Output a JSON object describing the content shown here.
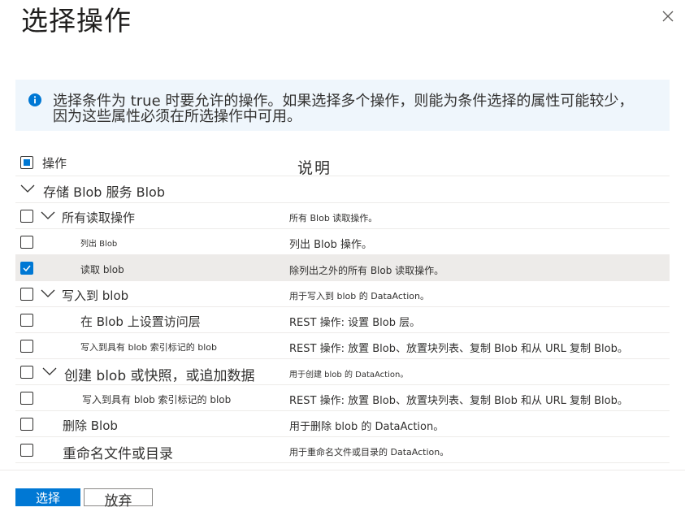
{
  "dialog": {
    "title": "选择操作",
    "close_icon": "close-icon"
  },
  "info": {
    "icon": "info-icon",
    "icon_color": "#0078d4",
    "background": "#eff6fc",
    "text": "选择条件为 true 时要允许的操作。如果选择多个操作，则能为条件选择的属性可能较少，因为这些属性必须在所选操作中可用。"
  },
  "grid": {
    "header_name": "操作",
    "header_desc": "说明",
    "group_label": "存储 Blob 服务 Blob",
    "rows": [
      {
        "name": "所有读取操作",
        "desc": "所有 Blob 读取操作。",
        "checked": false,
        "expandable": true
      },
      {
        "name": "列出 Blob",
        "desc": "列出 Blob 操作。",
        "checked": false,
        "expandable": false
      },
      {
        "name": "读取 blob",
        "desc": "除列出之外的所有 Blob 读取操作。",
        "checked": true,
        "expandable": false
      },
      {
        "name": "写入到 blob",
        "desc": "用于写入到 blob 的 DataAction。",
        "checked": false,
        "expandable": true
      },
      {
        "name": "在 Blob 上设置访问层",
        "desc": "REST 操作: 设置 Blob 层。",
        "checked": false,
        "expandable": false
      },
      {
        "name": "写入到具有 blob 索引标记的 blob",
        "desc": "REST 操作: 放置 Blob、放置块列表、复制 Blob 和从 URL 复制 Blob。",
        "checked": false,
        "expandable": false
      },
      {
        "name": "创建 blob 或快照，或追加数据",
        "desc": "用于创建 blob 的 DataAction。",
        "checked": false,
        "expandable": true
      },
      {
        "name": "写入到具有 blob 索引标记的 blob",
        "desc": "REST 操作: 放置 Blob、放置块列表、复制 Blob 和从 URL 复制 Blob。",
        "checked": false,
        "expandable": false
      },
      {
        "name": "删除 Blob",
        "desc": "用于删除 blob 的 DataAction。",
        "checked": false,
        "expandable": false
      },
      {
        "name": "重命名文件或目录",
        "desc": "用于重命名文件或目录的 DataAction。",
        "checked": false,
        "expandable": false
      }
    ]
  },
  "footer": {
    "select_label": "选择",
    "discard_label": "放弃"
  },
  "colors": {
    "accent": "#0078d4",
    "selected_row": "#edebe9"
  }
}
